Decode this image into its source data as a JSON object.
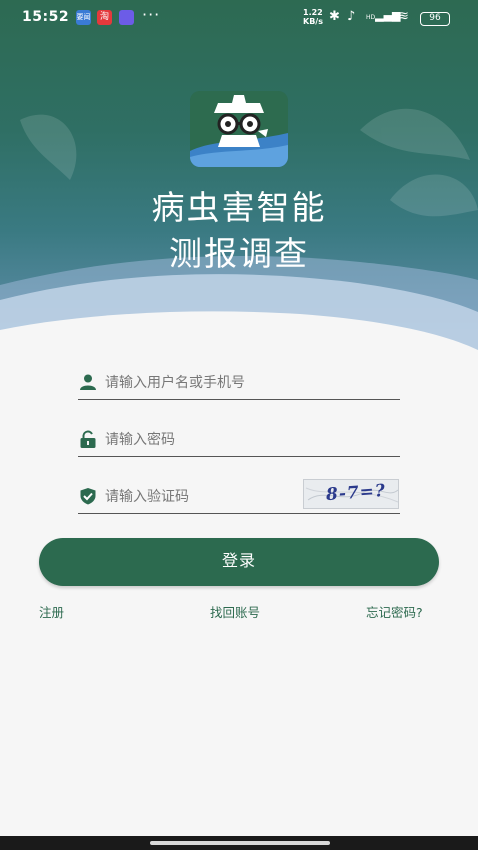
{
  "status_bar": {
    "time": "15:52",
    "app_icons": [
      "news-app-icon",
      "taobao-icon",
      "chat-app-icon"
    ],
    "app_icon_text": [
      "要闻",
      "淘",
      ""
    ],
    "overflow": "···",
    "net_speed": "1.22",
    "net_unit": "KB/s",
    "signal_label": "HD",
    "battery": "96"
  },
  "header": {
    "title_line1": "病虫害智能",
    "title_line2": "测报调查"
  },
  "form": {
    "username_placeholder": "请输入用户名或手机号",
    "password_placeholder": "请输入密码",
    "captcha_placeholder": "请输入验证码",
    "captcha_text": "8-7=?"
  },
  "actions": {
    "login": "登录",
    "register": "注册",
    "recover_account": "找回账号",
    "forgot_password": "忘记密码?"
  },
  "colors": {
    "primary": "#2c6a4f",
    "hero_top": "#2d6a52",
    "hero_bottom": "#6e95b8"
  }
}
